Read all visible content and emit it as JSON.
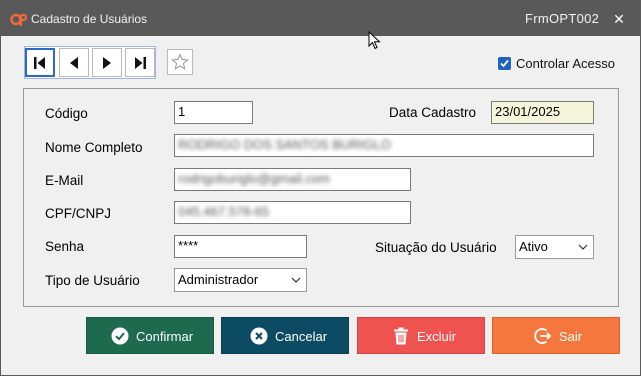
{
  "window": {
    "title": "Cadastro de Usuários",
    "form_code": "FrmOPT002",
    "close_glyph": "✕"
  },
  "toolbar": {
    "nav_buttons": [
      "first-record-icon",
      "previous-record-icon",
      "next-record-icon",
      "last-record-icon"
    ],
    "favorite_icon": "star-icon"
  },
  "access_control": {
    "label": "Controlar Acesso",
    "checked": true
  },
  "form": {
    "codigo_label": "Código",
    "codigo_value": "1",
    "data_cadastro_label": "Data Cadastro",
    "data_cadastro_value": "23/01/2025",
    "nome_label": "Nome Completo",
    "nome_value": "RODRIGO DOS SANTOS BURIGLO",
    "email_label": "E-Mail",
    "email_value": "rodrigoburiglo@gmail.com",
    "cpf_label": "CPF/CNPJ",
    "cpf_value": "045.467.578-65",
    "senha_label": "Senha",
    "senha_value": "****",
    "situacao_label": "Situação do Usuário",
    "situacao_value": "Ativo",
    "tipo_label": "Tipo de Usuário",
    "tipo_value": "Administrador"
  },
  "actions": {
    "confirm_label": "Confirmar",
    "cancel_label": "Cancelar",
    "delete_label": "Excluir",
    "exit_label": "Sair"
  },
  "colors": {
    "titlebar": "#595959",
    "confirm": "#1e6a4f",
    "cancel": "#0d4a63",
    "delete": "#ef5350",
    "exit": "#f5773d",
    "accent": "#1f62c1"
  }
}
